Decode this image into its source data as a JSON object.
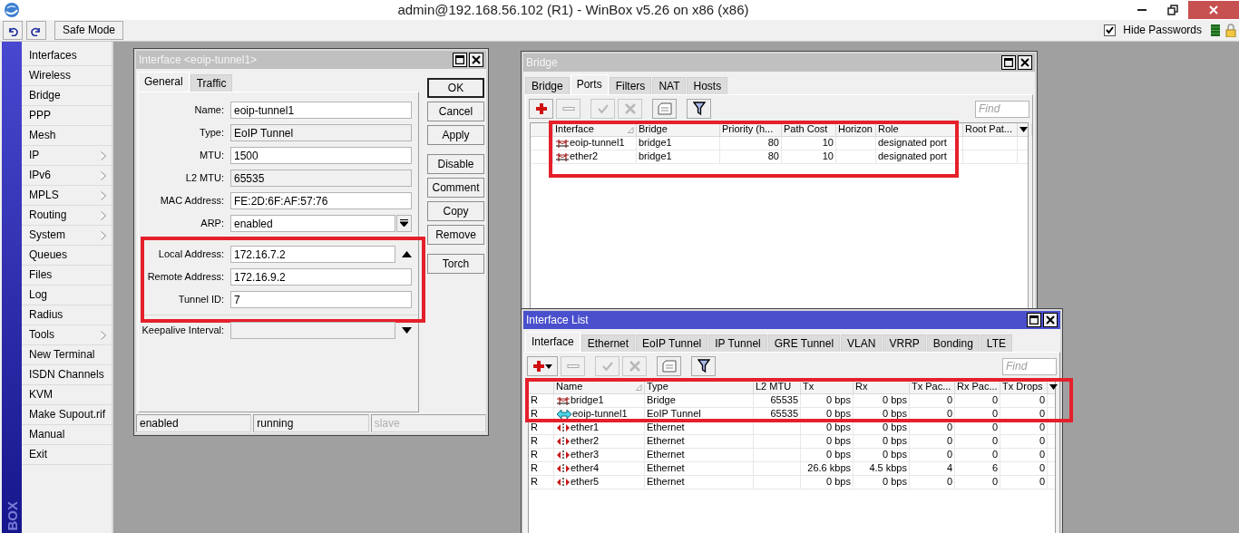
{
  "title_bar": {
    "title": "admin@192.168.56.102 (R1) - WinBox v5.26 on x86 (x86)"
  },
  "toolbar": {
    "safe_mode": "Safe Mode",
    "hide_passwords": {
      "label": "Hide Passwords",
      "checked": true
    }
  },
  "sidebar": {
    "brand": "BOX",
    "items": [
      {
        "label": "Interfaces",
        "submenu": false
      },
      {
        "label": "Wireless",
        "submenu": false
      },
      {
        "label": "Bridge",
        "submenu": false
      },
      {
        "label": "PPP",
        "submenu": false
      },
      {
        "label": "Mesh",
        "submenu": false
      },
      {
        "label": "IP",
        "submenu": true
      },
      {
        "label": "IPv6",
        "submenu": true
      },
      {
        "label": "MPLS",
        "submenu": true
      },
      {
        "label": "Routing",
        "submenu": true
      },
      {
        "label": "System",
        "submenu": true
      },
      {
        "label": "Queues",
        "submenu": false
      },
      {
        "label": "Files",
        "submenu": false
      },
      {
        "label": "Log",
        "submenu": false
      },
      {
        "label": "Radius",
        "submenu": false
      },
      {
        "label": "Tools",
        "submenu": true
      },
      {
        "label": "New Terminal",
        "submenu": false
      },
      {
        "label": "ISDN Channels",
        "submenu": false
      },
      {
        "label": "KVM",
        "submenu": false
      },
      {
        "label": "Make Supout.rif",
        "submenu": false
      },
      {
        "label": "Manual",
        "submenu": false
      },
      {
        "label": "Exit",
        "submenu": false
      }
    ]
  },
  "interface_dialog": {
    "title": "Interface <eoip-tunnel1>",
    "active": false,
    "tabs": [
      {
        "label": "General",
        "selected": true
      },
      {
        "label": "Traffic",
        "selected": false
      }
    ],
    "field_groups": [
      {
        "highlighted": false,
        "fields": [
          {
            "label": "Name:",
            "value": "eoip-tunnel1",
            "kind": "text"
          },
          {
            "label": "Type:",
            "value": "EoIP Tunnel",
            "kind": "readonly"
          },
          {
            "label": "MTU:",
            "value": "1500",
            "kind": "text"
          },
          {
            "label": "L2 MTU:",
            "value": "65535",
            "kind": "readonly"
          },
          {
            "label": "MAC Address:",
            "value": "FE:2D:6F:AF:57:76",
            "kind": "text"
          },
          {
            "label": "ARP:",
            "value": "enabled",
            "kind": "dropdown"
          }
        ]
      },
      {
        "highlighted": true,
        "fields": [
          {
            "label": "Local Address:",
            "value": "172.16.7.2",
            "kind": "collapse"
          },
          {
            "label": "Remote Address:",
            "value": "172.16.9.2",
            "kind": "text"
          },
          {
            "label": "Tunnel ID:",
            "value": "7",
            "kind": "text"
          }
        ]
      },
      {
        "highlighted": false,
        "fields": [
          {
            "label": "Keepalive Interval:",
            "kind": "expand"
          }
        ]
      }
    ],
    "button_groups": [
      [
        {
          "label": "OK",
          "default": true
        },
        {
          "label": "Cancel",
          "default": false
        },
        {
          "label": "Apply",
          "default": false
        }
      ],
      [
        {
          "label": "Disable",
          "default": false
        },
        {
          "label": "Comment",
          "default": false
        },
        {
          "label": "Copy",
          "default": false
        },
        {
          "label": "Remove",
          "default": false
        }
      ],
      [
        {
          "label": "Torch",
          "default": false
        }
      ]
    ],
    "status_bar": [
      {
        "text": "enabled",
        "disabled": false
      },
      {
        "text": "running",
        "disabled": false
      },
      {
        "text": "slave",
        "disabled": true
      }
    ]
  },
  "bridge_window": {
    "title": "Bridge",
    "active": false,
    "tabs": [
      {
        "label": "Bridge",
        "selected": false
      },
      {
        "label": "Ports",
        "selected": true
      },
      {
        "label": "Filters",
        "selected": false
      },
      {
        "label": "NAT",
        "selected": false
      },
      {
        "label": "Hosts",
        "selected": false
      }
    ],
    "find": {
      "placeholder": "Find"
    },
    "columns": [
      "Interface",
      "Bridge",
      "Priority (h...",
      "Path Cost",
      "Horizon",
      "Role",
      "Root Pat..."
    ],
    "rows": [
      {
        "kind": "bridge",
        "interface": "eoip-tunnel1",
        "bridge": "bridge1",
        "priority": "80",
        "path_cost": "10",
        "role": "designated port",
        "highlighted": true
      },
      {
        "kind": "bridge",
        "interface": "ether2",
        "bridge": "bridge1",
        "priority": "80",
        "path_cost": "10",
        "role": "designated port",
        "highlighted": true
      }
    ]
  },
  "interface_list": {
    "title": "Interface List",
    "active": true,
    "tabs": [
      {
        "label": "Interface",
        "selected": true
      },
      {
        "label": "Ethernet",
        "selected": false
      },
      {
        "label": "EoIP Tunnel",
        "selected": false
      },
      {
        "label": "IP Tunnel",
        "selected": false
      },
      {
        "label": "GRE Tunnel",
        "selected": false
      },
      {
        "label": "VLAN",
        "selected": false
      },
      {
        "label": "VRRP",
        "selected": false
      },
      {
        "label": "Bonding",
        "selected": false
      },
      {
        "label": "LTE",
        "selected": false
      }
    ],
    "find": {
      "placeholder": "Find"
    },
    "columns": [
      "Name",
      "Type",
      "L2 MTU",
      "Tx",
      "Rx",
      "Tx Pac...",
      "Rx Pac...",
      "Tx Drops"
    ],
    "rows": [
      {
        "flag": "R",
        "kind": "bridge",
        "name": "bridge1",
        "type": "Bridge",
        "l2_mtu": "65535",
        "tx": "0 bps",
        "rx": "0 bps",
        "tx_packets": "0",
        "rx_packets": "0",
        "tx_drops": "0",
        "highlighted": true
      },
      {
        "flag": "R",
        "kind": "eoip",
        "name": "eoip-tunnel1",
        "type": "EoIP Tunnel",
        "l2_mtu": "65535",
        "tx": "0 bps",
        "rx": "0 bps",
        "tx_packets": "0",
        "rx_packets": "0",
        "tx_drops": "0",
        "highlighted": true
      },
      {
        "flag": "R",
        "kind": "ethernet",
        "name": "ether1",
        "type": "Ethernet",
        "tx": "0 bps",
        "rx": "0 bps",
        "tx_packets": "0",
        "rx_packets": "0",
        "tx_drops": "0",
        "highlighted": false
      },
      {
        "flag": "R",
        "kind": "ethernet",
        "name": "ether2",
        "type": "Ethernet",
        "tx": "0 bps",
        "rx": "0 bps",
        "tx_packets": "0",
        "rx_packets": "0",
        "tx_drops": "0",
        "highlighted": false
      },
      {
        "flag": "R",
        "kind": "ethernet",
        "name": "ether3",
        "type": "Ethernet",
        "tx": "0 bps",
        "rx": "0 bps",
        "tx_packets": "0",
        "rx_packets": "0",
        "tx_drops": "0",
        "highlighted": false
      },
      {
        "flag": "R",
        "kind": "ethernet",
        "name": "ether4",
        "type": "Ethernet",
        "tx": "26.6 kbps",
        "rx": "4.5 kbps",
        "tx_packets": "4",
        "rx_packets": "6",
        "tx_drops": "0",
        "highlighted": false
      },
      {
        "flag": "R",
        "kind": "ethernet",
        "name": "ether5",
        "type": "Ethernet",
        "tx": "0 bps",
        "rx": "0 bps",
        "tx_packets": "0",
        "rx_packets": "0",
        "tx_drops": "0",
        "highlighted": false
      }
    ]
  }
}
